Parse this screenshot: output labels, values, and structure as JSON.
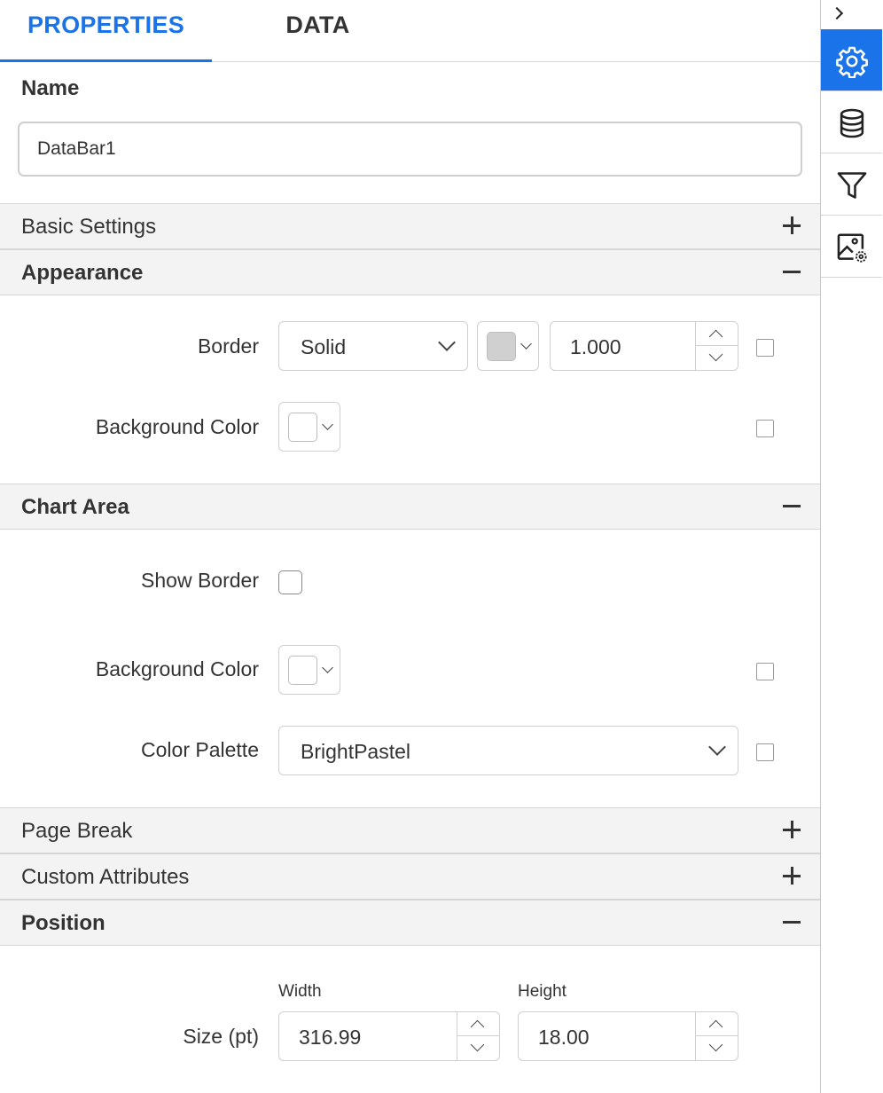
{
  "tabs": [
    {
      "label": "PROPERTIES",
      "active": true
    },
    {
      "label": "DATA",
      "active": false
    }
  ],
  "name": {
    "label": "Name",
    "value": "DataBar1"
  },
  "sections": {
    "basic_settings": {
      "title": "Basic Settings",
      "expanded": false
    },
    "appearance": {
      "title": "Appearance",
      "expanded": true
    },
    "chart_area": {
      "title": "Chart Area",
      "expanded": true
    },
    "page_break": {
      "title": "Page Break",
      "expanded": false
    },
    "custom_attributes": {
      "title": "Custom Attributes",
      "expanded": false
    },
    "position": {
      "title": "Position",
      "expanded": true
    }
  },
  "appearance": {
    "border": {
      "label": "Border",
      "style": "Solid",
      "color": "#d0d0d0",
      "width": "1.000"
    },
    "background_color": {
      "label": "Background Color",
      "color": "#ffffff"
    }
  },
  "chart_area": {
    "show_border": {
      "label": "Show Border",
      "checked": false
    },
    "background_color": {
      "label": "Background Color",
      "color": "#ffffff"
    },
    "color_palette": {
      "label": "Color Palette",
      "value": "BrightPastel"
    }
  },
  "position": {
    "size": {
      "label": "Size (pt)",
      "width_label": "Width",
      "width": "316.99",
      "height_label": "Height",
      "height": "18.00"
    }
  },
  "sidebar": {
    "items": [
      {
        "icon": "gear-icon",
        "active": true
      },
      {
        "icon": "database-icon",
        "active": false
      },
      {
        "icon": "filter-icon",
        "active": false
      },
      {
        "icon": "image-settings-icon",
        "active": false
      }
    ]
  },
  "colors": {
    "accent": "#1a73e8",
    "section_bg": "#f3f3f3",
    "border": "#cfcfcf"
  }
}
